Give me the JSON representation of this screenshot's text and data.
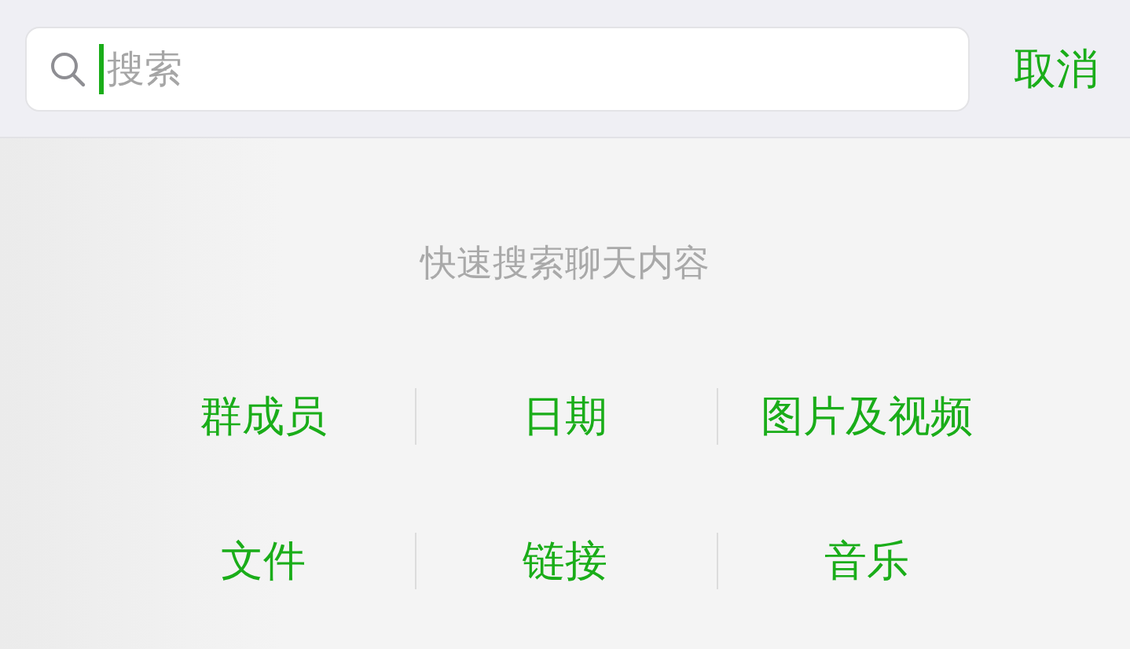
{
  "search": {
    "placeholder": "搜索"
  },
  "cancel_button": "取消",
  "hint": "快速搜索聊天内容",
  "categories": [
    {
      "label": "群成员"
    },
    {
      "label": "日期"
    },
    {
      "label": "图片及视频"
    },
    {
      "label": "文件"
    },
    {
      "label": "链接"
    },
    {
      "label": "音乐"
    }
  ]
}
